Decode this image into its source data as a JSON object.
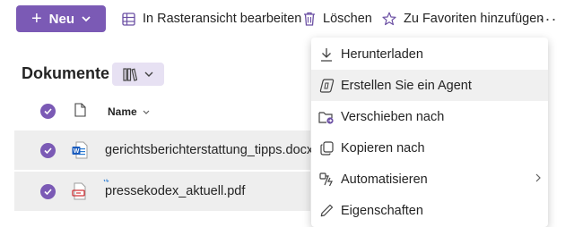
{
  "commandbar": {
    "new_label": "Neu",
    "grid_edit_label": "In Rasteransicht bearbeiten",
    "delete_label": "Löschen",
    "favorite_label": "Zu Favoriten hinzufügen",
    "more_label": "···"
  },
  "library": {
    "title": "Dokumente"
  },
  "table": {
    "name_header": "Name",
    "rows": [
      {
        "name": "gerichtsberichterstattung_tipps.docx",
        "type": "word"
      },
      {
        "name": "pressekodex_aktuell.pdf",
        "type": "pdf"
      }
    ]
  },
  "context_menu": {
    "items": [
      {
        "label": "Herunterladen",
        "icon": "download-icon"
      },
      {
        "label": "Erstellen Sie ein Agent",
        "icon": "agent-icon"
      },
      {
        "label": "Verschieben nach",
        "icon": "move-folder-icon"
      },
      {
        "label": "Kopieren nach",
        "icon": "copy-icon"
      },
      {
        "label": "Automatisieren",
        "icon": "automate-icon"
      },
      {
        "label": "Eigenschaften",
        "icon": "edit-pencil-icon"
      }
    ]
  },
  "colors": {
    "accent": "#7b5ab5",
    "selected_row": "#eeeeee",
    "view_switch_bg": "#e7e1f3"
  }
}
